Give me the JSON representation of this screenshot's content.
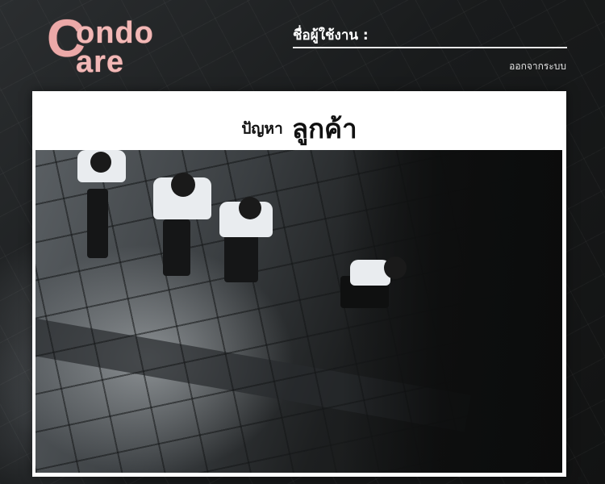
{
  "logo": {
    "letter": "C",
    "line1": "ondo",
    "line2": "are",
    "color": "#eca9a8"
  },
  "header": {
    "username_label": "ชื่อผู้ใช้งาน :",
    "username_value": "",
    "logout_label": "ออกจากระบบ"
  },
  "panel": {
    "title_prefix": "ปัญหา",
    "title_main": "ลูกค้า"
  },
  "colors": {
    "panel_bg": "#ffffff",
    "page_bg": "#1c1e1f",
    "logo_pink": "#eca9a8"
  },
  "icons": []
}
